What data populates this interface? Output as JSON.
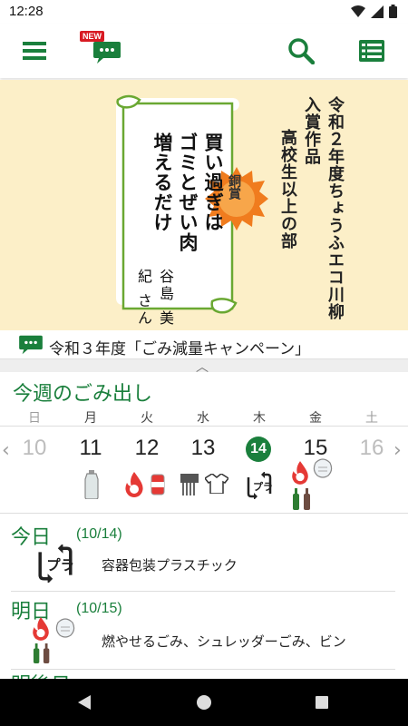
{
  "status_bar": {
    "time": "12:28"
  },
  "app_bar": {
    "menu_icon": "hamburger-menu-icon",
    "new_badge": "NEW",
    "chat_icon": "chat-bubble-icon",
    "search_icon": "search-icon",
    "list_icon": "list-icon"
  },
  "banner": {
    "award": "銅賞",
    "senryu_lines": [
      "買い過ぎは",
      "ゴミとぜい肉",
      "増えるだけ"
    ],
    "author": "谷島 美紀 さん",
    "title_lines": [
      "令和２年度ちょうふエコ川柳",
      "入賞作品",
      "高校生以上の部"
    ]
  },
  "campaign": {
    "text": "令和３年度「ごみ減量キャンペーン」"
  },
  "week": {
    "title": "今週のごみ出し",
    "day_names": [
      "日",
      "月",
      "火",
      "水",
      "木",
      "金",
      "土"
    ],
    "dates": [
      "10",
      "11",
      "12",
      "13",
      "14",
      "15",
      "16"
    ]
  },
  "schedule": {
    "today": {
      "label": "今日",
      "date": "(10/14)",
      "desc": "容器包装プラスチック"
    },
    "tomorrow": {
      "label": "明日",
      "date": "(10/15)",
      "desc": "燃やせるごみ、シュレッダーごみ、ビン"
    },
    "day_after": {
      "label": "明後日"
    }
  },
  "colors": {
    "accent": "#1a7f3c",
    "banner_bg": "#fcefc8",
    "badge": "#d81b23",
    "award": "#f07c1e"
  }
}
